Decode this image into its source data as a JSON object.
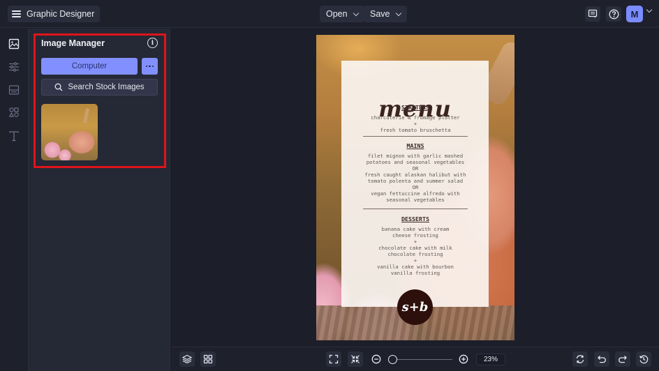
{
  "header": {
    "app_title": "Graphic Designer",
    "open_label": "Open",
    "save_label": "Save",
    "avatar_initial": "M",
    "icons": [
      "menu-icon",
      "feedback-icon",
      "help-icon",
      "chevron-down-icon"
    ]
  },
  "rail": {
    "items": [
      {
        "name": "images",
        "icon": "image-icon",
        "active": true
      },
      {
        "name": "adjustments",
        "icon": "sliders-icon",
        "active": false
      },
      {
        "name": "layouts",
        "icon": "layout-icon",
        "active": false
      },
      {
        "name": "graphics",
        "icon": "shapes-icon",
        "active": false
      },
      {
        "name": "text",
        "icon": "text-icon",
        "active": false
      }
    ]
  },
  "panel": {
    "title": "Image Manager",
    "computer_label": "Computer",
    "stock_label": "Search Stock Images",
    "thumbnails": [
      {
        "alt": "pumpkin with pink flowers"
      }
    ],
    "highlight_color": "#e0141b"
  },
  "canvas": {
    "menu": {
      "title": "menu",
      "sections": [
        {
          "heading": "STARTERS",
          "lines": [
            "charcuterie & fromage platter",
            "+",
            "fresh tomato bruschetta"
          ]
        },
        {
          "heading": "MAINS",
          "lines": [
            "filet mignon with garlic mashed",
            "potatoes and seasonal vegetables",
            "OR",
            "fresh caught alaskan halibut with",
            "tomato polenta and summer salad",
            "OR",
            "vegan fettuccine alfredo with",
            "seasonal vegetables"
          ]
        },
        {
          "heading": "DESSERTS",
          "lines": [
            "banana cake with cream",
            "cheese frosting",
            "+",
            "chocolate cake with milk",
            "chocolate frosting",
            "+",
            "vanilla cake with bourbon",
            "vanilla frosting"
          ]
        }
      ],
      "logo_text": "s+b"
    }
  },
  "footer": {
    "zoom_percent": "23%",
    "zoom_value": 23,
    "accent": "#8290ff"
  }
}
